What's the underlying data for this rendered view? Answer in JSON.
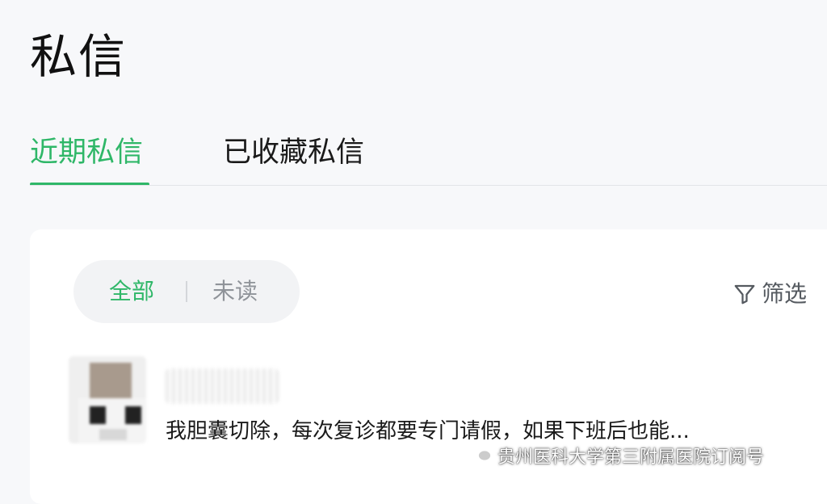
{
  "page": {
    "title": "私信"
  },
  "tabs": [
    {
      "label": "近期私信",
      "active": true
    },
    {
      "label": "已收藏私信",
      "active": false
    }
  ],
  "filter_segment": {
    "all_label": "全部",
    "unread_label": "未读",
    "selected": "全部"
  },
  "filter": {
    "label": "筛选",
    "icon": "funnel-icon"
  },
  "messages": [
    {
      "preview": "我胆囊切除，每次复诊都要专门请假，如果下班后也能..."
    }
  ],
  "watermark": {
    "text": "贵州医科大学第三附属医院订阅号",
    "icon": "wechat-icon"
  },
  "colors": {
    "accent": "#2fb768",
    "background": "#f7f8fa",
    "card": "#ffffff",
    "muted_text": "#8f9399"
  }
}
